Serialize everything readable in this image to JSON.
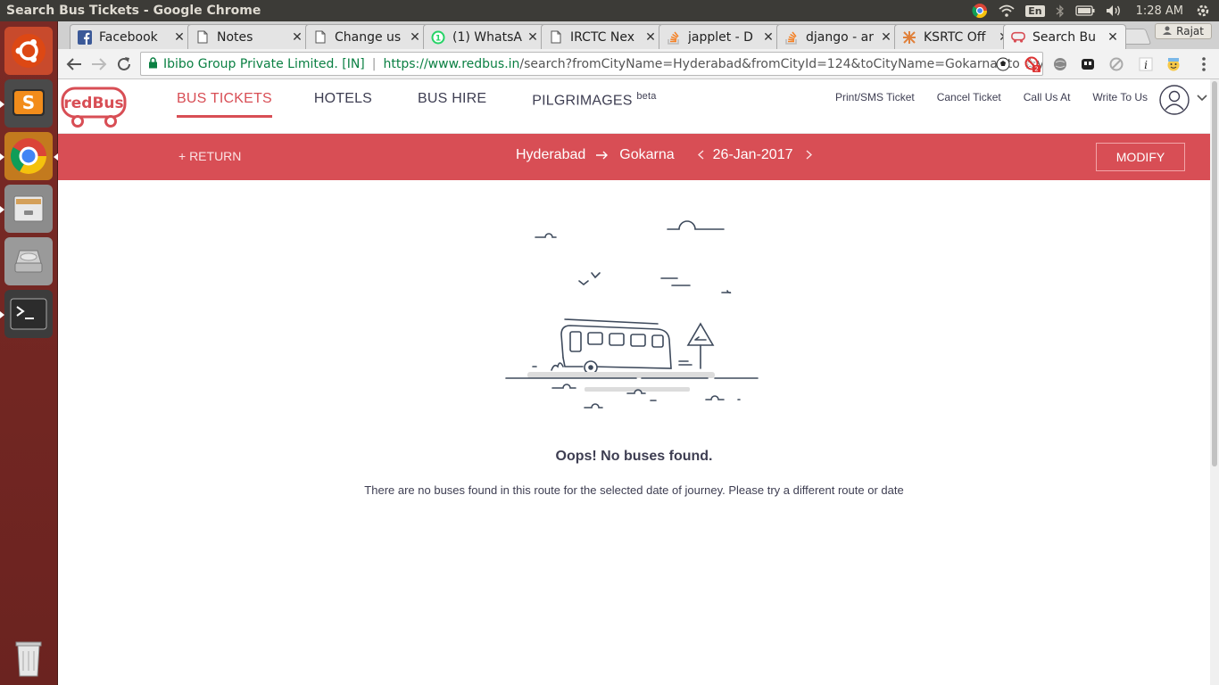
{
  "os": {
    "window_title": "Search Bus Tickets - Google Chrome",
    "keyboard_layout": "En",
    "clock": "1:28 AM"
  },
  "launcher": {
    "items": [
      "ubuntu-dash",
      "sublime-text",
      "google-chrome",
      "files",
      "disks",
      "terminal",
      "trash"
    ]
  },
  "browser": {
    "tabs": [
      {
        "label": "Facebook",
        "favicon": "facebook-icon"
      },
      {
        "label": "Notes",
        "favicon": "page-icon"
      },
      {
        "label": "Change us",
        "favicon": "page-icon"
      },
      {
        "label": "(1) WhatsA",
        "favicon": "whatsapp-icon",
        "badge": "1"
      },
      {
        "label": "IRCTC Nex",
        "favicon": "page-icon"
      },
      {
        "label": "japplet - D",
        "favicon": "stackoverflow-icon"
      },
      {
        "label": "django - ar",
        "favicon": "stackoverflow-icon"
      },
      {
        "label": "KSRTC Off",
        "favicon": "ksrtc-icon"
      },
      {
        "label": "Search Bu",
        "favicon": "redbus-icon",
        "active": true
      }
    ],
    "profile_name": "Rajat",
    "omnibox": {
      "ev_label": "Ibibo Group Private Limited. [IN]",
      "url_host": "https://www.redbus.in",
      "url_rest": "/search?fromCityName=Hyderabad&fromCityId=124&toCityName=Gokarna&toCityI"
    },
    "extension_badge": "2"
  },
  "site": {
    "logo_text": "redBus",
    "nav": [
      {
        "label": "BUS TICKETS",
        "active": true
      },
      {
        "label": "HOTELS"
      },
      {
        "label": "BUS HIRE"
      },
      {
        "label": "PILGRIMAGES",
        "sup": "beta"
      }
    ],
    "top_links": [
      "Print/SMS Ticket",
      "Cancel Ticket",
      "Call Us At",
      "Write To Us"
    ],
    "search": {
      "return_label": "+ RETURN",
      "from": "Hyderabad",
      "to": "Gokarna",
      "date": "26-Jan-2017",
      "modify_label": "MODIFY"
    },
    "empty_state": {
      "title": "Oops! No buses found.",
      "message": "There are no buses found in this route for the selected date of journey. Please try a different route or date"
    },
    "brand_color": "#d84e55"
  }
}
